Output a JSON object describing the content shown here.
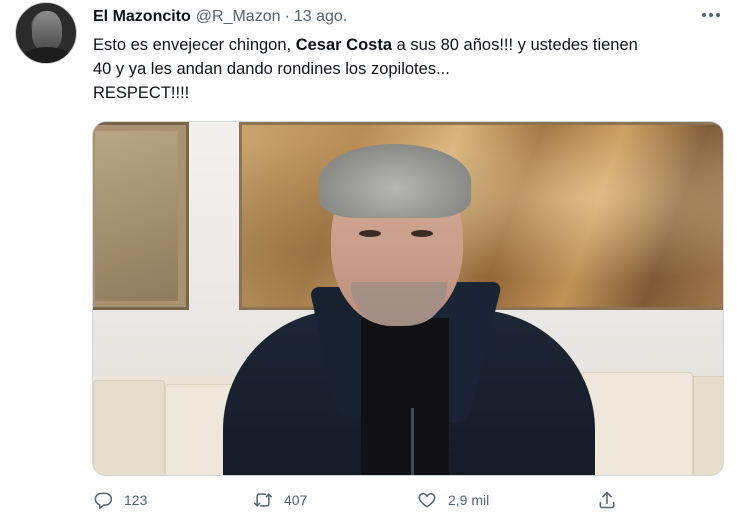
{
  "tweet": {
    "author": {
      "name": "El Mazoncito",
      "handle": "@R_Mazon",
      "separator": "·",
      "date": "13 ago."
    },
    "text": {
      "line1_before": "Esto es envejecer chingon, ",
      "line1_bold": "Cesar Costa",
      "line1_after": " a sus 80 años!!! y ustedes tienen",
      "line2": "40 y ya les andan dando rondines los zopilotes...",
      "line3": "RESPECT!!!!"
    },
    "actions": {
      "replies": "123",
      "retweets": "407",
      "likes": "2,9 mil"
    },
    "icons": {
      "more": "more-horizontal-icon",
      "reply": "reply-icon",
      "retweet": "retweet-icon",
      "like": "heart-icon",
      "share": "share-icon"
    },
    "colors": {
      "text": "#0f1419",
      "secondary": "#536471",
      "border": "#cfd9de"
    }
  }
}
